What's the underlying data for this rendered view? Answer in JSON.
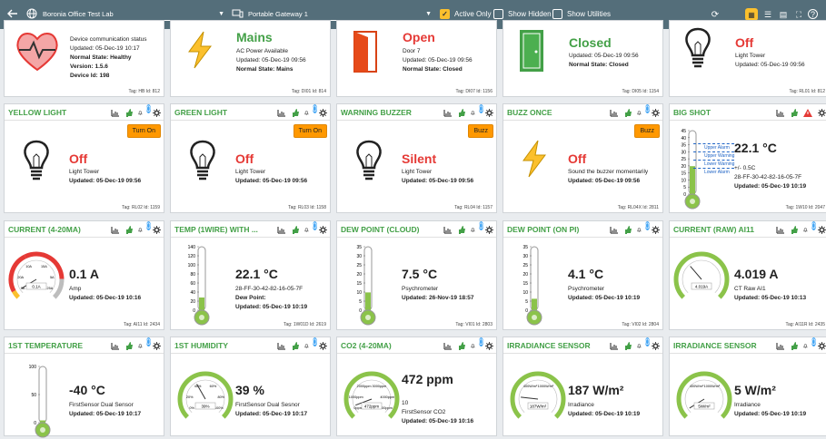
{
  "topbar": {
    "site": "Boronia Office Test Lab",
    "gateway": "Portable Gateway 1",
    "active_only": "Active Only",
    "show_hidden": "Show Hidden",
    "show_utilities": "Show Utilities"
  },
  "row1": [
    {
      "state": "",
      "lines": [
        "Device communication status",
        "Updated: 05-Dec-19 10:17",
        "Normal State: Healthy",
        "Version: 1.5.6",
        "Device Id: 198"
      ],
      "foot": "Tag: HB    Id: 812"
    },
    {
      "state": "Mains",
      "lines": [
        "AC Power Available",
        "Updated: 05-Dec-19 09:56",
        "Normal State: Mains"
      ],
      "foot": "Tag: DI01    Id: 814"
    },
    {
      "state": "Open",
      "lines": [
        "Door 7",
        "Updated: 05-Dec-19 09:56",
        "Normal State: Closed"
      ],
      "foot": "Tag: DI07    Id: 1156"
    },
    {
      "state": "Closed",
      "lines": [
        "Updated: 05-Dec-19 09:56",
        "Normal State: Closed"
      ],
      "foot": "Tag: DI05    Id: 1154"
    },
    {
      "state": "Off",
      "lines": [
        "Light Tower",
        "Updated: 05-Dec-19 09:56"
      ],
      "foot": "Tag: RL01    Id: 812"
    }
  ],
  "row2": [
    {
      "title": "YELLOW LIGHT",
      "btn": "Turn On",
      "state": "Off",
      "lines": [
        "Light Tower",
        "Updated: 05-Dec-19 09:56"
      ],
      "foot": "Tag: RL02    Id: 1159"
    },
    {
      "title": "GREEN LIGHT",
      "btn": "Turn On",
      "state": "Off",
      "lines": [
        "Light Tower",
        "Updated: 05-Dec-19 09:56"
      ],
      "foot": "Tag: RL03    Id: 1158"
    },
    {
      "title": "WARNING BUZZER",
      "btn": "Buzz",
      "state": "Silent",
      "lines": [
        "Light Tower",
        "Updated: 05-Dec-19 09:56"
      ],
      "foot": "Tag: RL04    Id: 1157"
    },
    {
      "title": "BUZZ ONCE",
      "btn": "Buzz",
      "state": "Off",
      "lines": [
        "Sound the buzzer momentarily",
        "Updated: 05-Dec-19 09:56"
      ],
      "foot": "Tag: RL04X    Id: 2811"
    },
    {
      "title": "BIG SHOT",
      "value": "22.1 °C",
      "lines": [
        "+/- 0.5C",
        "28-FF-30-42-82-16-05-7F",
        "Updated: 05-Dec-19 10:19"
      ],
      "foot": "Tag: 1W10    Id: 2047",
      "alarms": [
        "Upper Alarm",
        "Upper Warning",
        "Lower Warning",
        "Lower Alarm"
      ],
      "ticks": [
        "45",
        "40",
        "35",
        "30",
        "25",
        "20",
        "15",
        "10",
        "5",
        "0"
      ]
    }
  ],
  "row3": [
    {
      "title": "CURRENT (4-20MA)",
      "value": "0.1 A",
      "lines": [
        "Amp",
        "Updated: 05-Dec-19 10:16"
      ],
      "foot": "Tag: AI11    Id: 2434",
      "gauge": "0.1A",
      "gticks": [
        "10A",
        "15A",
        "20A",
        "5A",
        "0A",
        "25A"
      ]
    },
    {
      "title": "TEMP (1WIRE) WITH ...",
      "value": "22.1 °C",
      "lines": [
        "28-FF-30-42-82-16-05-7F",
        "Dew Point:",
        "Updated: 05-Dec-19 10:19"
      ],
      "foot": "Tag: 1W01D    Id: 2619",
      "ticks": [
        "140",
        "120",
        "100",
        "80",
        "60",
        "40",
        "20",
        "0"
      ]
    },
    {
      "title": "DEW POINT (CLOUD)",
      "value": "7.5 °C",
      "lines": [
        "Psychrometer",
        "Updated: 26-Nov-19 18:57"
      ],
      "foot": "Tag: VI01    Id: 2803",
      "ticks": [
        "35",
        "30",
        "25",
        "20",
        "15",
        "10",
        "5",
        "0"
      ]
    },
    {
      "title": "DEW POINT (ON PI)",
      "value": "4.1 °C",
      "lines": [
        "Psychrometer",
        "Updated: 05-Dec-19 10:19"
      ],
      "foot": "Tag: VI02    Id: 2804",
      "ticks": [
        "35",
        "30",
        "25",
        "20",
        "15",
        "10",
        "5",
        "0"
      ]
    },
    {
      "title": "CURRENT (RAW) AI11",
      "value": "4.019 A",
      "lines": [
        "CT Raw AI1",
        "Updated: 05-Dec-19 10:13"
      ],
      "foot": "Tag: AI11R    Id: 2435",
      "gauge": "4.019A",
      "gticks": [
        "",
        "",
        "",
        "",
        "",
        ""
      ]
    }
  ],
  "row4": [
    {
      "title": "1ST TEMPERATURE",
      "value": "-40 °C",
      "lines": [
        "FirstSensor Dual Sensor",
        "Updated: 05-Dec-19 10:17"
      ],
      "ticks": [
        "100",
        "50",
        "0"
      ]
    },
    {
      "title": "1ST HUMIDITY",
      "value": "39 %",
      "lines": [
        "FirstSensor Dual Sesnor",
        "Updated: 05-Dec-19 10:17"
      ],
      "gauge": "39%",
      "gticks": [
        "40%",
        "60%",
        "20%",
        "80%",
        "0%",
        "100%"
      ]
    },
    {
      "title": "CO2 (4-20MA)",
      "value": "472 ppm",
      "lines": [
        "10",
        "FirstSensor CO2",
        "Updated: 05-Dec-19 10:16"
      ],
      "gauge": "472ppm",
      "gticks": [
        "2000ppm",
        "3000ppm",
        "1000ppm",
        "4000ppm",
        "0ppm",
        "5000ppm"
      ]
    },
    {
      "title": "IRRADIANCE SENSOR",
      "value": "187 W/m²",
      "lines": [
        "Irradiance",
        "Updated: 05-Dec-19 10:19"
      ],
      "gauge": "187W/m²",
      "gticks": [
        "400W/m²",
        "1000W/m²",
        "",
        "",
        "",
        ""
      ]
    },
    {
      "title": "IRRADIANCE SENSOR",
      "value": "5 W/m²",
      "lines": [
        "Irradiance",
        "Updated: 05-Dec-19 10:19"
      ],
      "gauge": "5W/m²",
      "gticks": [
        "400W/m²",
        "1000W/m²",
        "",
        "",
        "",
        ""
      ]
    }
  ],
  "colors": {
    "topbar": "#546e7a",
    "green": "#43a047",
    "red": "#e53935",
    "orange": "#ff9800",
    "gauge": "#8bc34a"
  }
}
